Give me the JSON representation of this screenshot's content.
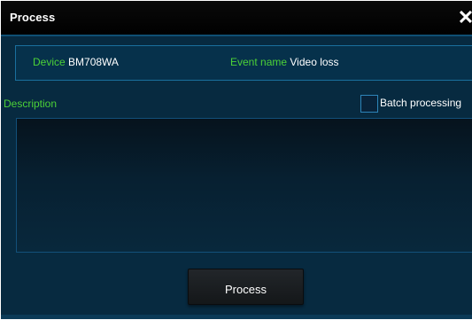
{
  "dialog": {
    "title": "Process",
    "close_glyph": "✕"
  },
  "info": {
    "device_label": "Device",
    "device_value": "BM708WA",
    "event_label": "Event name",
    "event_value": "Video loss"
  },
  "form": {
    "description_label": "Description",
    "batch_label": "Batch processing",
    "batch_checked": false,
    "description_value": ""
  },
  "actions": {
    "process_label": "Process"
  },
  "colors": {
    "label_green": "#4cd137",
    "panel_blue": "#072a40",
    "titlebar": "#000000"
  }
}
